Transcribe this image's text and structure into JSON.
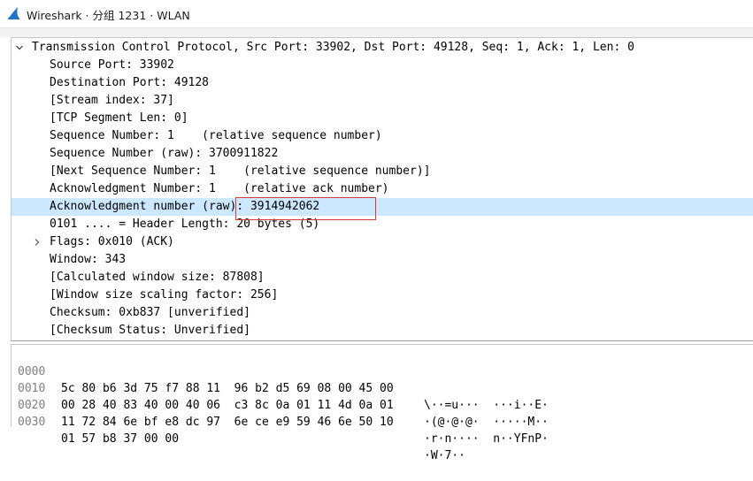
{
  "window": {
    "title": "Wireshark · 分组 1231 · WLAN",
    "icon": "wireshark-fin-icon",
    "icon_color": "#1e73c8"
  },
  "packet_details": {
    "root": {
      "label": "Transmission Control Protocol, Src Port: 33902, Dst Port: 49128, Seq: 1, Ack: 1, Len: 0",
      "expanded": true
    },
    "fields": [
      {
        "label": "Source Port: 33902"
      },
      {
        "label": "Destination Port: 49128"
      },
      {
        "label": "[Stream index: 37]"
      },
      {
        "label": "[TCP Segment Len: 0]"
      },
      {
        "label": "Sequence Number: 1    (relative sequence number)"
      },
      {
        "label": "Sequence Number (raw): 3700911822"
      },
      {
        "label": "[Next Sequence Number: 1    (relative sequence number)]"
      },
      {
        "label": "Acknowledgment Number: 1    (relative ack number)"
      },
      {
        "label": "Acknowledgment number (raw): 3914942062",
        "selected": true
      },
      {
        "label": "0101 .... = Header Length: 20 bytes (5)"
      },
      {
        "label": "Flags: 0x010 (ACK)",
        "collapsed": true
      },
      {
        "label": "Window: 343"
      },
      {
        "label": "[Calculated window size: 87808]"
      },
      {
        "label": "[Window size scaling factor: 256]"
      },
      {
        "label": "Checksum: 0xb837 [unverified]"
      },
      {
        "label": "[Checksum Status: Unverified]"
      }
    ],
    "selection_color": "#cce8ff",
    "annotation_color": "#d63a3a"
  },
  "hex_dump": {
    "rows": [
      {
        "offset": "0000",
        "bytes": "5c 80 b6 3d 75 f7 88 11  96 b2 d5 69 08 00 45 00",
        "ascii": "\\··=u···  ···i··E·"
      },
      {
        "offset": "0010",
        "bytes": "00 28 40 83 40 00 40 06  c3 8c 0a 01 11 4d 0a 01",
        "ascii": "·(@·@·@·  ·····M··"
      },
      {
        "offset": "0020",
        "bytes": "11 72 84 6e bf e8 dc 97  6e ce e9 59 46 6e 50 10",
        "ascii": "·r·n····  n··YFnP·"
      },
      {
        "offset": "0030",
        "bytes": "01 57 b8 37 00 00",
        "ascii": "·W·7··"
      }
    ]
  }
}
